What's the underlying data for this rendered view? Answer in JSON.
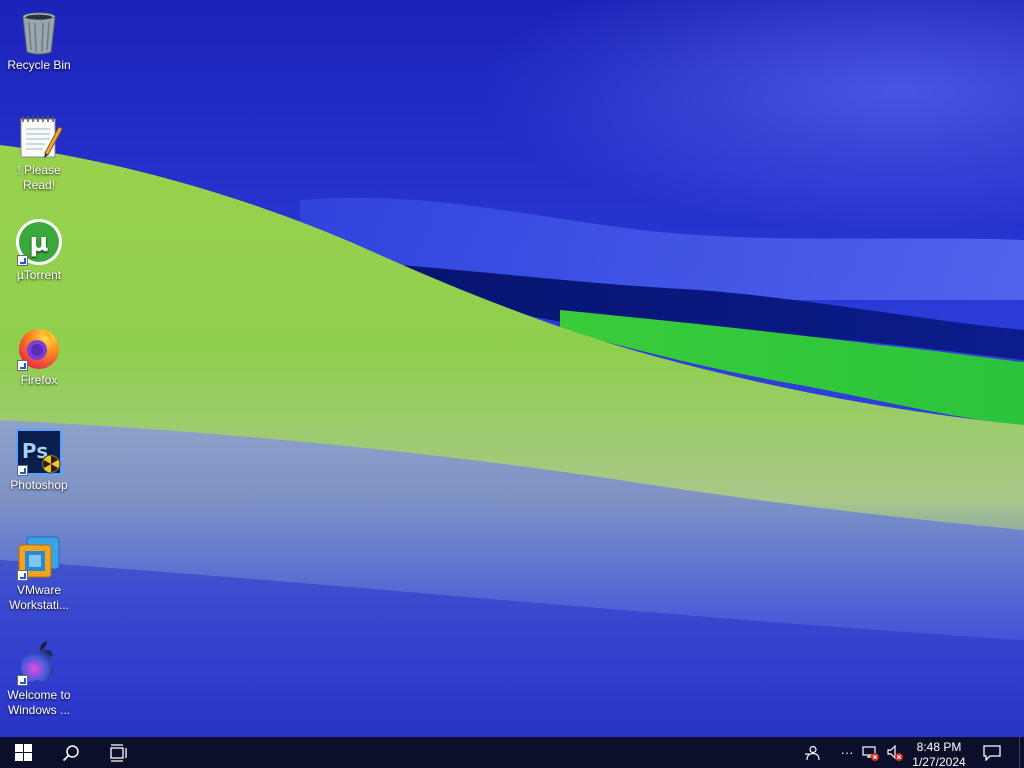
{
  "desktop": {
    "icons": [
      {
        "label": "Recycle Bin",
        "icon": "recycle-bin-icon"
      },
      {
        "label": "! Please Read!",
        "icon": "notepad-icon"
      },
      {
        "label": "µTorrent",
        "icon": "utorrent-icon"
      },
      {
        "label": "Firefox",
        "icon": "firefox-icon"
      },
      {
        "label": "Photoshop",
        "icon": "photoshop-icon"
      },
      {
        "label": "VMware Workstati...",
        "icon": "vmware-icon"
      },
      {
        "label": "Welcome to Windows ...",
        "icon": "apple-icon"
      }
    ]
  },
  "taskbar": {
    "start_icon": "windows-start-icon",
    "search_icon": "search-icon",
    "task_view_icon": "task-view-icon",
    "tray": {
      "people_icon": "people-icon",
      "overflow_label": "···",
      "network_icon": "network-disconnected-icon",
      "volume_icon": "volume-muted-icon"
    },
    "clock": {
      "time": "8:48 PM",
      "date": "1/27/2024"
    },
    "notifications_icon": "action-center-icon"
  },
  "colors": {
    "taskbar": "#0b0f2a",
    "wallpaper_blue": "#2a3ad6",
    "wallpaper_green": "#8ed04a"
  }
}
